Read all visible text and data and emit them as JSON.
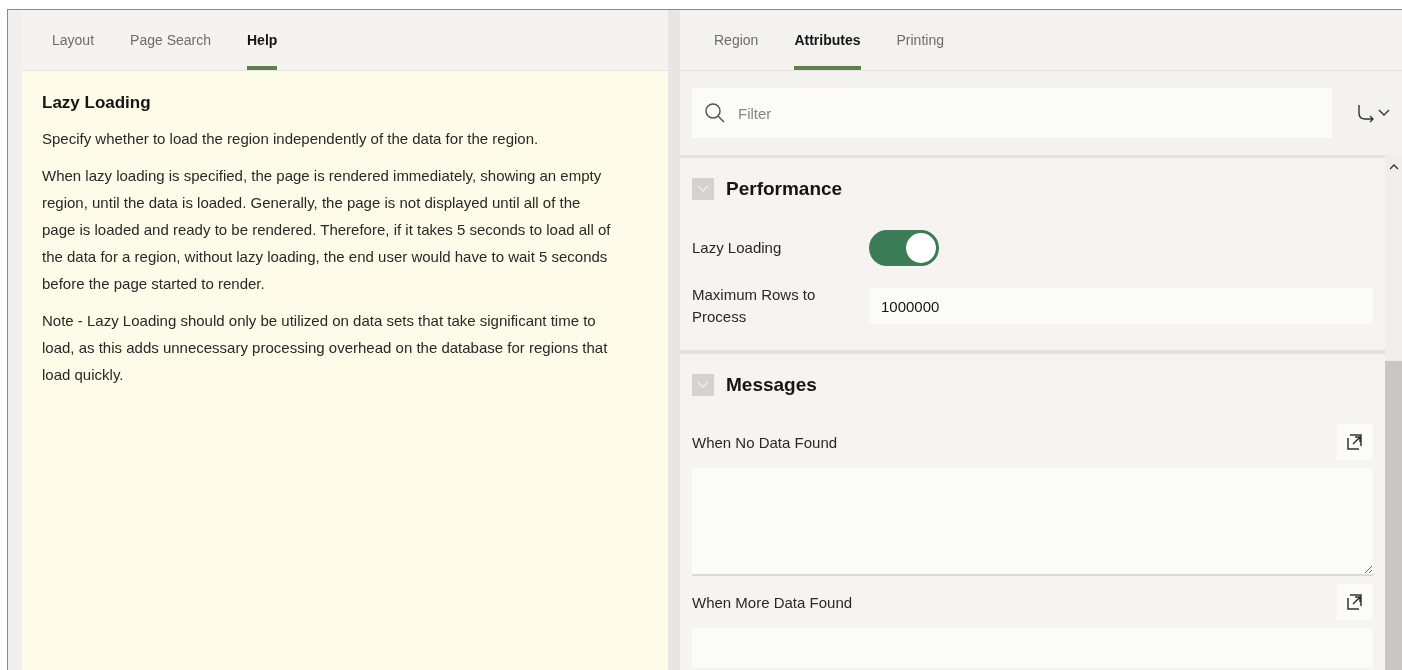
{
  "left_tabs": [
    {
      "label": "Layout",
      "selected": false
    },
    {
      "label": "Page Search",
      "selected": false
    },
    {
      "label": "Help",
      "selected": true
    }
  ],
  "help": {
    "title": "Lazy Loading",
    "paragraphs": [
      "Specify whether to load the region independently of the data for the region.",
      "When lazy loading is specified, the page is rendered immediately, showing an empty region, until the data is loaded. Generally, the page is not displayed until all of the page is loaded and ready to be rendered. Therefore, if it takes 5 seconds to load all of the data for a region, without lazy loading, the end user would have to wait 5 seconds before the page started to render.",
      "Note - Lazy Loading should only be utilized on data sets that take significant time to load, as this adds unnecessary processing overhead on the database for regions that load quickly."
    ]
  },
  "right_tabs": [
    {
      "label": "Region",
      "selected": false
    },
    {
      "label": "Attributes",
      "selected": true
    },
    {
      "label": "Printing",
      "selected": false
    }
  ],
  "filter": {
    "placeholder": "Filter"
  },
  "sections": [
    {
      "title": "Performance",
      "expanded": true,
      "fields": [
        {
          "kind": "toggle",
          "label": "Lazy Loading",
          "on": true
        },
        {
          "kind": "text",
          "label": "Maximum Rows to Process",
          "value": "1000000"
        }
      ]
    },
    {
      "title": "Messages",
      "expanded": true,
      "fields": [
        {
          "kind": "textarea",
          "label": "When No Data Found"
        },
        {
          "kind": "textarea_cut",
          "label": "When More Data Found"
        }
      ]
    }
  ]
}
